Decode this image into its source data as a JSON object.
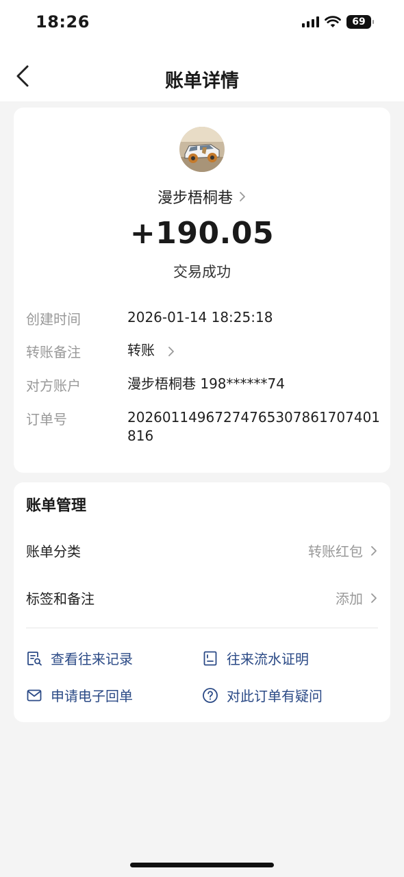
{
  "status_bar": {
    "time": "18:26",
    "battery": "69"
  },
  "nav": {
    "title": "账单详情"
  },
  "summary": {
    "name": "漫步梧桐巷",
    "amount": "+190.05",
    "status": "交易成功"
  },
  "details": [
    {
      "label": "创建时间",
      "value": "2026-01-14 18:25:18"
    },
    {
      "label": "转账备注",
      "value": "转账"
    },
    {
      "label": "对方账户",
      "value": "漫步梧桐巷 198******74"
    },
    {
      "label": "订单号",
      "value_line1": "2026011496727476530786170740​1",
      "value_line2": "816"
    }
  ],
  "management": {
    "title": "账单管理",
    "category_label": "账单分类",
    "category_value": "转账红包",
    "tags_label": "标签和备注",
    "tags_value": "添加"
  },
  "actions": {
    "history": "查看往来记录",
    "statement": "往来流水证明",
    "receipt": "申请电子回单",
    "question": "对此订单有疑问"
  },
  "colors": {
    "accent": "#2b4a86",
    "background": "#f4f4f4",
    "muted": "#999999"
  }
}
